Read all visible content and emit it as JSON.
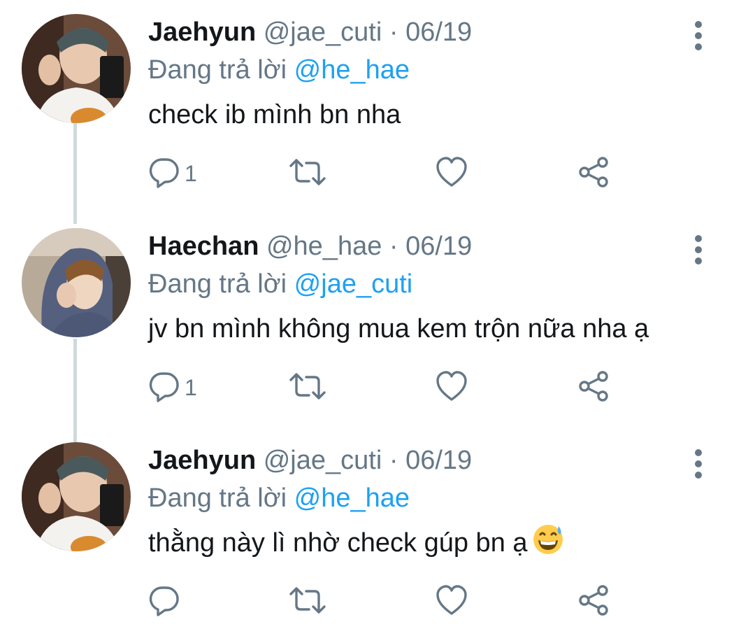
{
  "tweets": [
    {
      "name": "Jaehyun",
      "handle": "@jae_cuti",
      "separator": "·",
      "date": "06/19",
      "reply_prefix": "Đang trả lời",
      "reply_to": "@he_hae",
      "text": "check ib mình bn nha",
      "emoji": "",
      "reply_count": "1",
      "avatar": "avatar-jaehyun"
    },
    {
      "name": "Haechan",
      "handle": "@he_hae",
      "separator": "·",
      "date": "06/19",
      "reply_prefix": "Đang trả lời",
      "reply_to": "@jae_cuti",
      "text": "jv bn mình không mua kem trộn nữa nha ạ",
      "emoji": "",
      "reply_count": "1",
      "avatar": "avatar-haechan"
    },
    {
      "name": "Jaehyun",
      "handle": "@jae_cuti",
      "separator": "·",
      "date": "06/19",
      "reply_prefix": "Đang trả lời",
      "reply_to": "@he_hae",
      "text": "thằng này lì nhờ check gúp bn ạ",
      "emoji": "grinning-sweat-emoji",
      "reply_count": "",
      "avatar": "avatar-jaehyun"
    }
  ],
  "icons": {
    "reply": "reply-icon",
    "retweet": "retweet-icon",
    "like": "heart-icon",
    "share": "share-icon",
    "more": "more-vertical-icon"
  },
  "colors": {
    "name": "#14171a",
    "secondary": "#657786",
    "mention": "#1da1f2",
    "thread_line": "#cfd9de"
  }
}
